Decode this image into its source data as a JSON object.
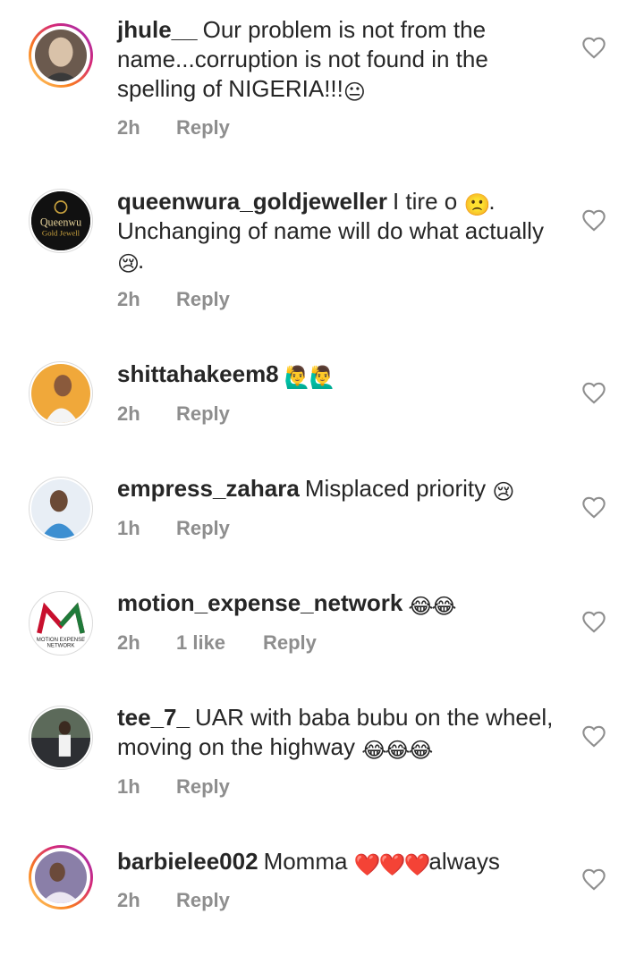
{
  "comments": [
    {
      "username": "jhule__",
      "text": "Our problem is not from the name...corruption is not found in the spelling of NIGERIA!!!",
      "emoji": "😐",
      "time": "2h",
      "likes": "",
      "reply_label": "Reply",
      "avatar": "person-photo-icon"
    },
    {
      "username": "queenwura_goldjeweller",
      "text_part1": "I tire o",
      "emoji1": "🙁",
      "text_part2": ". Unchanging of name will do what actually",
      "emoji2": "😢",
      "text_part3": ".",
      "time": "2h",
      "likes": "",
      "reply_label": "Reply",
      "avatar_text_1": "Queenwu",
      "avatar_text_2": "Gold Jewell"
    },
    {
      "username": "shittahakeem8",
      "emoji": "🙋‍♂️🙋‍♂️",
      "time": "2h",
      "likes": "",
      "reply_label": "Reply",
      "avatar": "person-photo-icon"
    },
    {
      "username": "empress_zahara",
      "text": "Misplaced priority",
      "emoji": "😢",
      "time": "1h",
      "likes": "",
      "reply_label": "Reply",
      "avatar": "person-photo-icon"
    },
    {
      "username": "motion_expense_network",
      "emoji": "😂😂",
      "time": "2h",
      "likes": "1 like",
      "reply_label": "Reply",
      "avatar_text_1": "MOTION EXPENSE",
      "avatar_text_2": "NETWORK"
    },
    {
      "username": "tee_7_",
      "text": "UAR with baba bubu on the wheel, moving on the highway",
      "emoji": "😂😂😂",
      "time": "1h",
      "likes": "",
      "reply_label": "Reply",
      "avatar": "person-photo-icon"
    },
    {
      "username": "barbielee002",
      "text_part1": "Momma",
      "emoji": "❤️❤️❤️",
      "text_part2": "always",
      "time": "2h",
      "likes": "",
      "reply_label": "Reply",
      "avatar": "person-photo-icon"
    }
  ],
  "colors": {
    "text": "#262626",
    "meta": "#8e8e8e",
    "ring_gradient": [
      "#feda75",
      "#fa7e1e",
      "#d62976",
      "#962fbf"
    ]
  },
  "icons": {
    "like": "heart-outline-icon"
  }
}
